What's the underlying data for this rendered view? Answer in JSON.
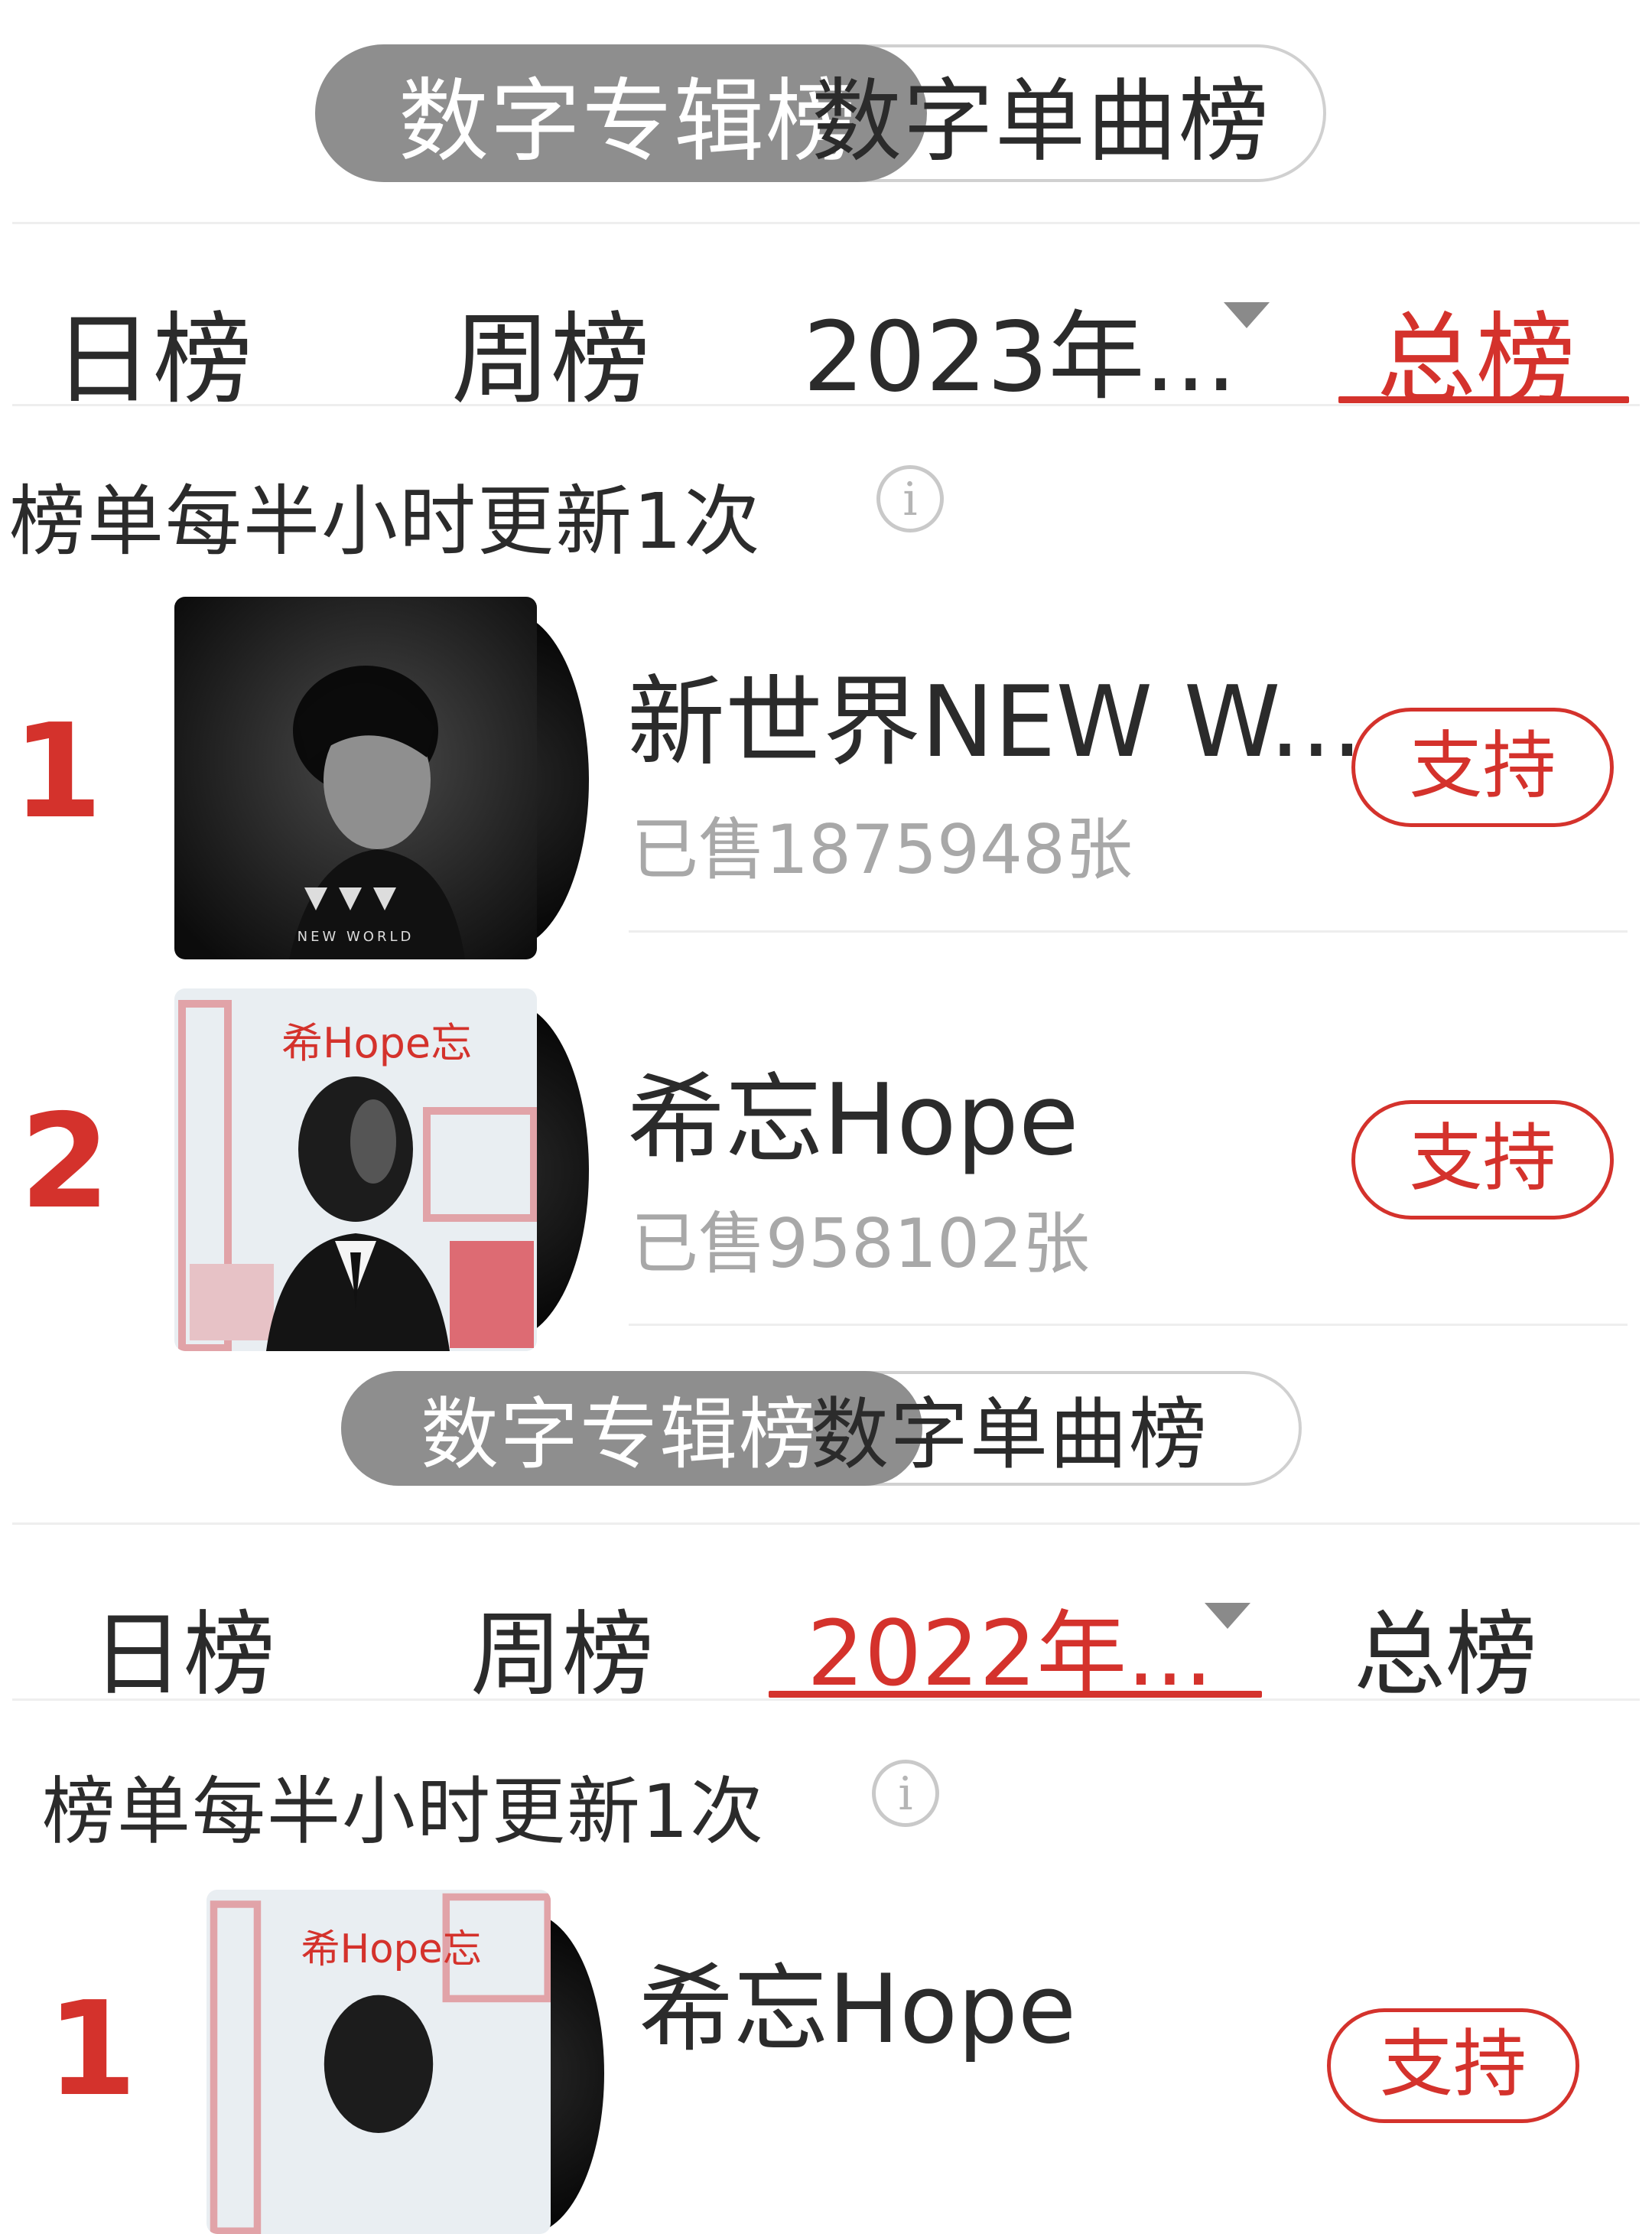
{
  "colors": {
    "accent": "#d4322c",
    "pill": "#8e8e8e",
    "muted": "#a8a8a8"
  },
  "sections": [
    {
      "toggle": {
        "active": "数字专辑榜",
        "inactive": "数字单曲榜"
      },
      "tabs": {
        "day": "日榜",
        "week": "周榜",
        "year": "2023年...",
        "total": "总榜",
        "selected": "总榜"
      },
      "note": "榜单每半小时更新1次",
      "items": [
        {
          "rank": "1",
          "title": "新世界NEW W...",
          "sold": "已售1875948张",
          "support": "支持",
          "cover_text": "NEW WORLD",
          "cover_icon": "portrait-dark-cover"
        },
        {
          "rank": "2",
          "title": "希忘Hope",
          "sold": "已售958102张",
          "support": "支持",
          "cover_text": "希Hope忘",
          "cover_icon": "masked-figure-cover"
        }
      ]
    },
    {
      "toggle": {
        "active": "数字专辑榜",
        "inactive": "数字单曲榜"
      },
      "tabs": {
        "day": "日榜",
        "week": "周榜",
        "year": "2022年...",
        "total": "总榜",
        "selected": "2022年..."
      },
      "note": "榜单每半小时更新1次",
      "items": [
        {
          "rank": "1",
          "title": "希忘Hope",
          "support": "支持",
          "cover_text": "希Hope忘",
          "cover_icon": "masked-figure-cover"
        }
      ]
    }
  ]
}
